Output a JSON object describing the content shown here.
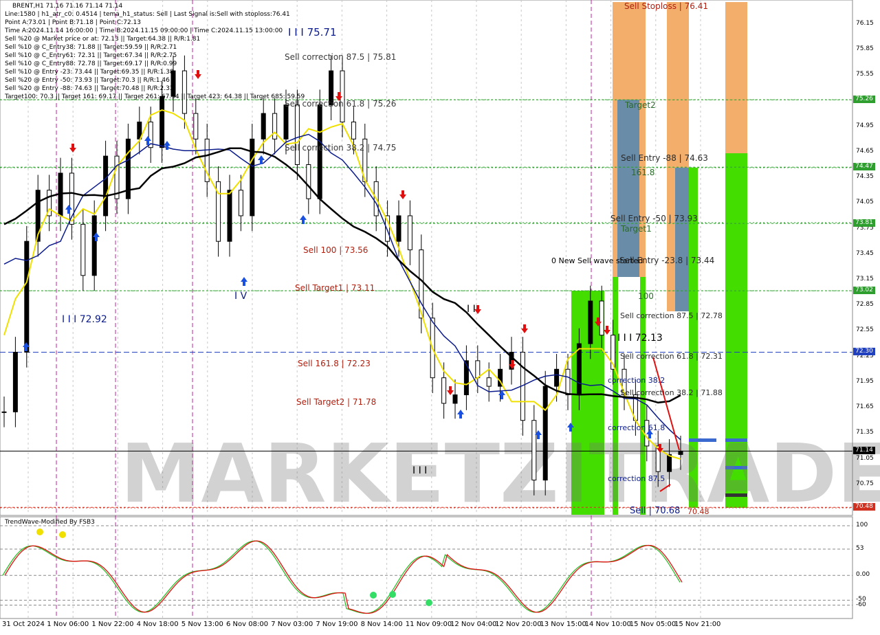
{
  "header": {
    "symbol_line": "BRENT,H1  71.16 71.16 71.14 71.14",
    "lines": [
      "Line:1580  |  h1_atr_c0: 0.4514  |  tema_h1_status: Sell  |  Last Signal is:Sell with stoploss:76.41",
      "Point A:73.01  |  Point B:71.18  |  Point C:72.13",
      "Time A:2024.11.14 16:00:00  |  Time B:2024.11.15 09:00:00  |  Time C:2024.11.15 13:00:00",
      "Sell %20 @ Market price or at: 72.13  ||  Target:64.38  ||  R/R:1.81",
      "Sell %10 @ C_Entry38: 71.88  ||  Target:59.59  ||  R/R:2.71",
      "Sell %10 @ C_Entry61: 72.31  ||  Target:67.34  ||  R/R:2.75",
      "Sell %10 @ C_Entry88: 72.78  ||  Target:69.17  ||  R/R:0.99",
      "Sell %10 @ Entry -23: 73.44  ||  Target:69.35  ||  R/R:1.38",
      "Sell %20 @ Entry -50: 73.93  ||  Target:70.3  ||  R/R:1.46",
      "Sell %20 @ Entry -88: 74.63  ||  Target:70.48  ||  R/R:2.33",
      "Target100: 70.3  ||  Target 161: 69.17  ||  Target 261: 67.34  ||  Target 423: 64.38  ||  Target 685: 59.59"
    ]
  },
  "price_axis": {
    "ticks": [
      "76.15",
      "75.85",
      "75.55",
      "75.25",
      "74.95",
      "74.65",
      "74.35",
      "74.05",
      "73.75",
      "73.45",
      "73.15",
      "72.85",
      "72.55",
      "72.25",
      "71.95",
      "71.65",
      "71.35",
      "71.05",
      "70.75"
    ]
  },
  "price_tags": [
    {
      "value": "75.26",
      "color": "#2e9e2e"
    },
    {
      "value": "74.47",
      "color": "#2e9e2e"
    },
    {
      "value": "73.81",
      "color": "#2e9e2e"
    },
    {
      "value": "73.02",
      "color": "#2e9e2e"
    },
    {
      "value": "72.30",
      "color": "#2040c0"
    },
    {
      "value": "71.14",
      "color": "#000000"
    },
    {
      "value": "70.48",
      "color": "#d03020"
    }
  ],
  "time_axis": {
    "labels": [
      "31 Oct 2024",
      "1 Nov 06:00",
      "1 Nov 22:00",
      "4 Nov 18:00",
      "5 Nov 13:00",
      "6 Nov 08:00",
      "7 Nov 03:00",
      "7 Nov 19:00",
      "8 Nov 14:00",
      "11 Nov 09:00",
      "12 Nov 04:00",
      "12 Nov 20:00",
      "13 Nov 15:00",
      "14 Nov 10:00",
      "15 Nov 05:00",
      "15 Nov 21:00"
    ]
  },
  "annotations": {
    "wave_top": "I I I 75.71",
    "sell_correction_875": "Sell correction 87.5 | 75.81",
    "sell_correction_618": "Sell correction 61.8 | 75.26",
    "sell_correction_382": "Sell correction 38.2 | 74.75",
    "sell_100": "Sell 100 | 73.56",
    "sell_target1": "Sell Target1 | 73.11",
    "sell_1618": "Sell 161.8 | 72.23",
    "sell_target2": "Sell Target2 | 71.78",
    "wave_iv": "I V",
    "wave_iii": "I I I 72.92",
    "wave_v_low": "I I I",
    "wave_ii": "I I",
    "sell_stoploss": "Sell Stoploss | 76.41",
    "target2": "Target2",
    "sell_entry_88": "Sell Entry -88 | 74.63",
    "fib_1618": "161.8",
    "sell_entry_50": "Sell Entry -50 | 73.93",
    "target1": "Target1",
    "new_sell_wave": "0 New Sell wave started",
    "sell_entry_23": "Sell Entry -23.8 | 73.44",
    "fib_100": "100",
    "sell_corr_878": "Sell correction 87.5 | 72.78",
    "point_c": "I I I 72.13",
    "sell_corr_618b": "Sell correction 61.8 | 72.31",
    "correction_382": "correction 38.2",
    "sell_corr_382b": "Sell correction 38.2 | 71.88",
    "correction_618": "correction 61.8",
    "correction_875": "correction 87.5",
    "sell_target_low": "Sell | 70.68",
    "target_70": "70.48"
  },
  "indicator": {
    "title": "TrendWave-Modified By FSB3",
    "levels": [
      "100",
      "53",
      "0.00",
      "-50",
      "-60"
    ]
  },
  "watermark": "MARKETZITRADE",
  "colors": {
    "bull": "#2e9e2e",
    "bear": "#d03020",
    "ma_blue": "#0a1a8a",
    "ma_black": "#000000",
    "ma_yellow": "#f0e000",
    "green_zone": "#44dd00",
    "orange_zone": "#f0a050",
    "steel_zone": "#5a8ab0"
  },
  "chart_data": {
    "type": "line",
    "title": "",
    "xlabel": "",
    "ylabel": "",
    "ylim": [
      70.45,
      76.35
    ],
    "series": [
      {
        "name": "BRENT H1 close",
        "values": [
          71.6,
          72.3,
          73.6,
          74.2,
          73.9,
          74.4,
          73.8,
          73.2,
          73.9,
          74.6,
          74.1,
          74.8,
          75.0,
          74.7,
          75.3,
          75.6,
          75.1,
          74.8,
          74.3,
          73.6,
          74.2,
          73.9,
          74.8,
          75.1,
          74.8,
          75.2,
          74.5,
          74.1,
          75.2,
          75.6,
          75.0,
          74.8,
          74.3,
          73.9,
          73.6,
          73.9,
          73.5,
          72.7,
          72.0,
          71.7,
          71.8,
          72.2,
          72.0,
          71.9,
          72.1,
          72.3,
          71.5,
          70.8,
          71.9,
          72.1,
          71.8,
          72.4,
          72.9,
          72.5,
          72.1,
          71.8,
          71.5,
          71.2,
          70.9,
          71.1,
          71.14
        ]
      }
    ]
  }
}
